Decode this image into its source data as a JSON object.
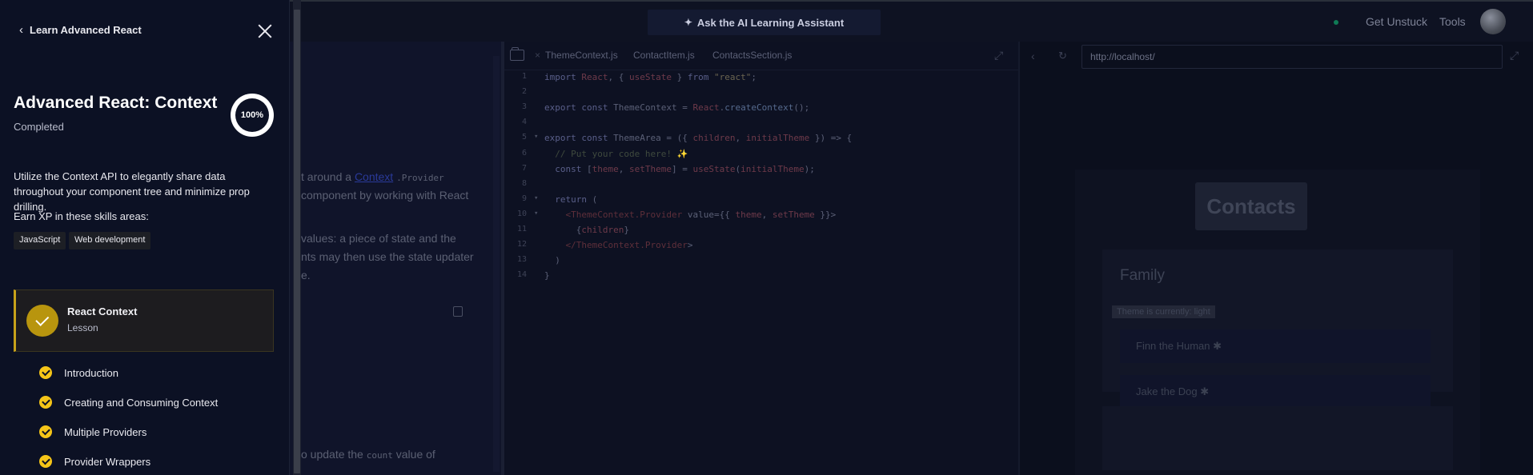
{
  "topbar": {
    "assistant_label": "Ask the AI Learning Assistant",
    "get_unstuck_label": "Get Unstuck",
    "tools_label": "Tools"
  },
  "sidebar": {
    "back_label": "Learn Advanced React",
    "module_title": "Advanced React: Context",
    "module_status": "Completed",
    "progress_label": "100%",
    "progress_value": 1.0,
    "description": "Utilize the Context API to elegantly share data throughout your component tree and minimize prop drilling.",
    "xp_label": "Earn XP in these skills areas:",
    "skills": [
      "JavaScript",
      "Web development"
    ],
    "current_lesson": {
      "title": "React Context",
      "type": "Lesson"
    },
    "items": [
      {
        "label": "Introduction",
        "done": true
      },
      {
        "label": "Creating and Consuming Context",
        "done": true
      },
      {
        "label": "Multiple Providers",
        "done": true
      },
      {
        "label": "Provider Wrappers",
        "done": true
      }
    ],
    "accent_color": "#f5c518"
  },
  "lesson": {
    "line1_pre": "t around a ",
    "line1_link": "Context",
    "line1_code": ".Provider",
    "line2": "component by working with React",
    "line3": "values: a piece of state and the",
    "line4": "nts may then use the state updater",
    "line5": "e.",
    "line6_pre": "o update the ",
    "line6_code": "count",
    "line6_post": " value of"
  },
  "editor": {
    "tabs": [
      "ThemeContext.js",
      "ContactItem.js",
      "ContactsSection.js"
    ],
    "active_tab": "ThemeContext.js",
    "lines": [
      "import React, { useState } from \"react\";",
      "",
      "export const ThemeContext = React.createContext();",
      "",
      "export const ThemeArea = ({ children, initialTheme }) => {",
      "  // Put your code here! ✨",
      "  const [theme, setTheme] = useState(initialTheme);",
      "",
      "  return (",
      "    <ThemeContext.Provider value={{ theme, setTheme }}>",
      "      {children}",
      "    </ThemeContext.Provider>",
      "  )",
      "}"
    ],
    "line_numbers": [
      "1",
      "2",
      "3",
      "4",
      "5",
      "6",
      "7",
      "8",
      "9",
      "10",
      "11",
      "12",
      "13",
      "14"
    ]
  },
  "preview": {
    "url": "http://localhost/",
    "page_title": "Contacts",
    "section_title": "Family",
    "theme_badge": "Theme is currently: light",
    "contacts": [
      "Finn the Human ✱",
      "Jake the Dog ✱"
    ]
  }
}
